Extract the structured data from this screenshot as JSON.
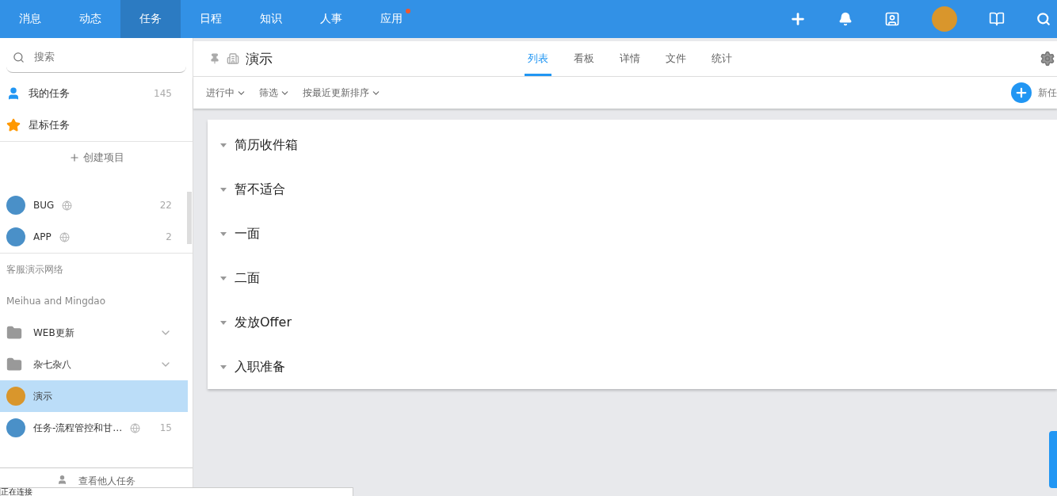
{
  "nav": {
    "items": [
      {
        "label": "消息",
        "selected": false,
        "badge": false
      },
      {
        "label": "动态",
        "selected": false,
        "badge": false
      },
      {
        "label": "任务",
        "selected": true,
        "badge": false
      },
      {
        "label": "日程",
        "selected": false,
        "badge": false
      },
      {
        "label": "知识",
        "selected": false,
        "badge": false
      },
      {
        "label": "人事",
        "selected": false,
        "badge": false
      },
      {
        "label": "应用",
        "selected": false,
        "badge": true
      }
    ]
  },
  "sidebar": {
    "search": {
      "placeholder": "搜索"
    },
    "fixed": [
      {
        "kind": "person",
        "label": "我的任务",
        "count": "145"
      },
      {
        "kind": "star",
        "label": "星标任务"
      }
    ],
    "create_project": "创建项目",
    "projects": [
      {
        "kind": "project",
        "label": "BUG",
        "public": true,
        "count": "22",
        "selected": false
      },
      {
        "kind": "project",
        "label": "APP",
        "public": true,
        "count": "2",
        "selected": false
      },
      {
        "kind": "group",
        "label": "客服演示网络"
      },
      {
        "kind": "group",
        "label": "Meihua and Mingdao"
      },
      {
        "kind": "folder",
        "label": "WEB更新"
      },
      {
        "kind": "folder",
        "label": "杂七杂八"
      },
      {
        "kind": "personal",
        "label": "演示",
        "public": false,
        "selected": true
      },
      {
        "kind": "project",
        "label": "任务-流程管控和甘…",
        "public": true,
        "count": "15",
        "selected": false
      }
    ],
    "footer": "查看他人任务"
  },
  "status": "正在连接",
  "header": {
    "title": "演示",
    "tabs": [
      {
        "label": "列表",
        "selected": true
      },
      {
        "label": "看板",
        "selected": false
      },
      {
        "label": "详情",
        "selected": false
      },
      {
        "label": "文件",
        "selected": false
      },
      {
        "label": "统计",
        "selected": false
      }
    ],
    "filters": [
      "进行中",
      "筛选",
      "按最近更新排序"
    ],
    "new_task": "新任"
  },
  "stages": [
    {
      "label": "简历收件箱"
    },
    {
      "label": "暂不适合"
    },
    {
      "label": "一面"
    },
    {
      "label": "二面"
    },
    {
      "label": "发放Offer"
    },
    {
      "label": "入职准备"
    }
  ]
}
